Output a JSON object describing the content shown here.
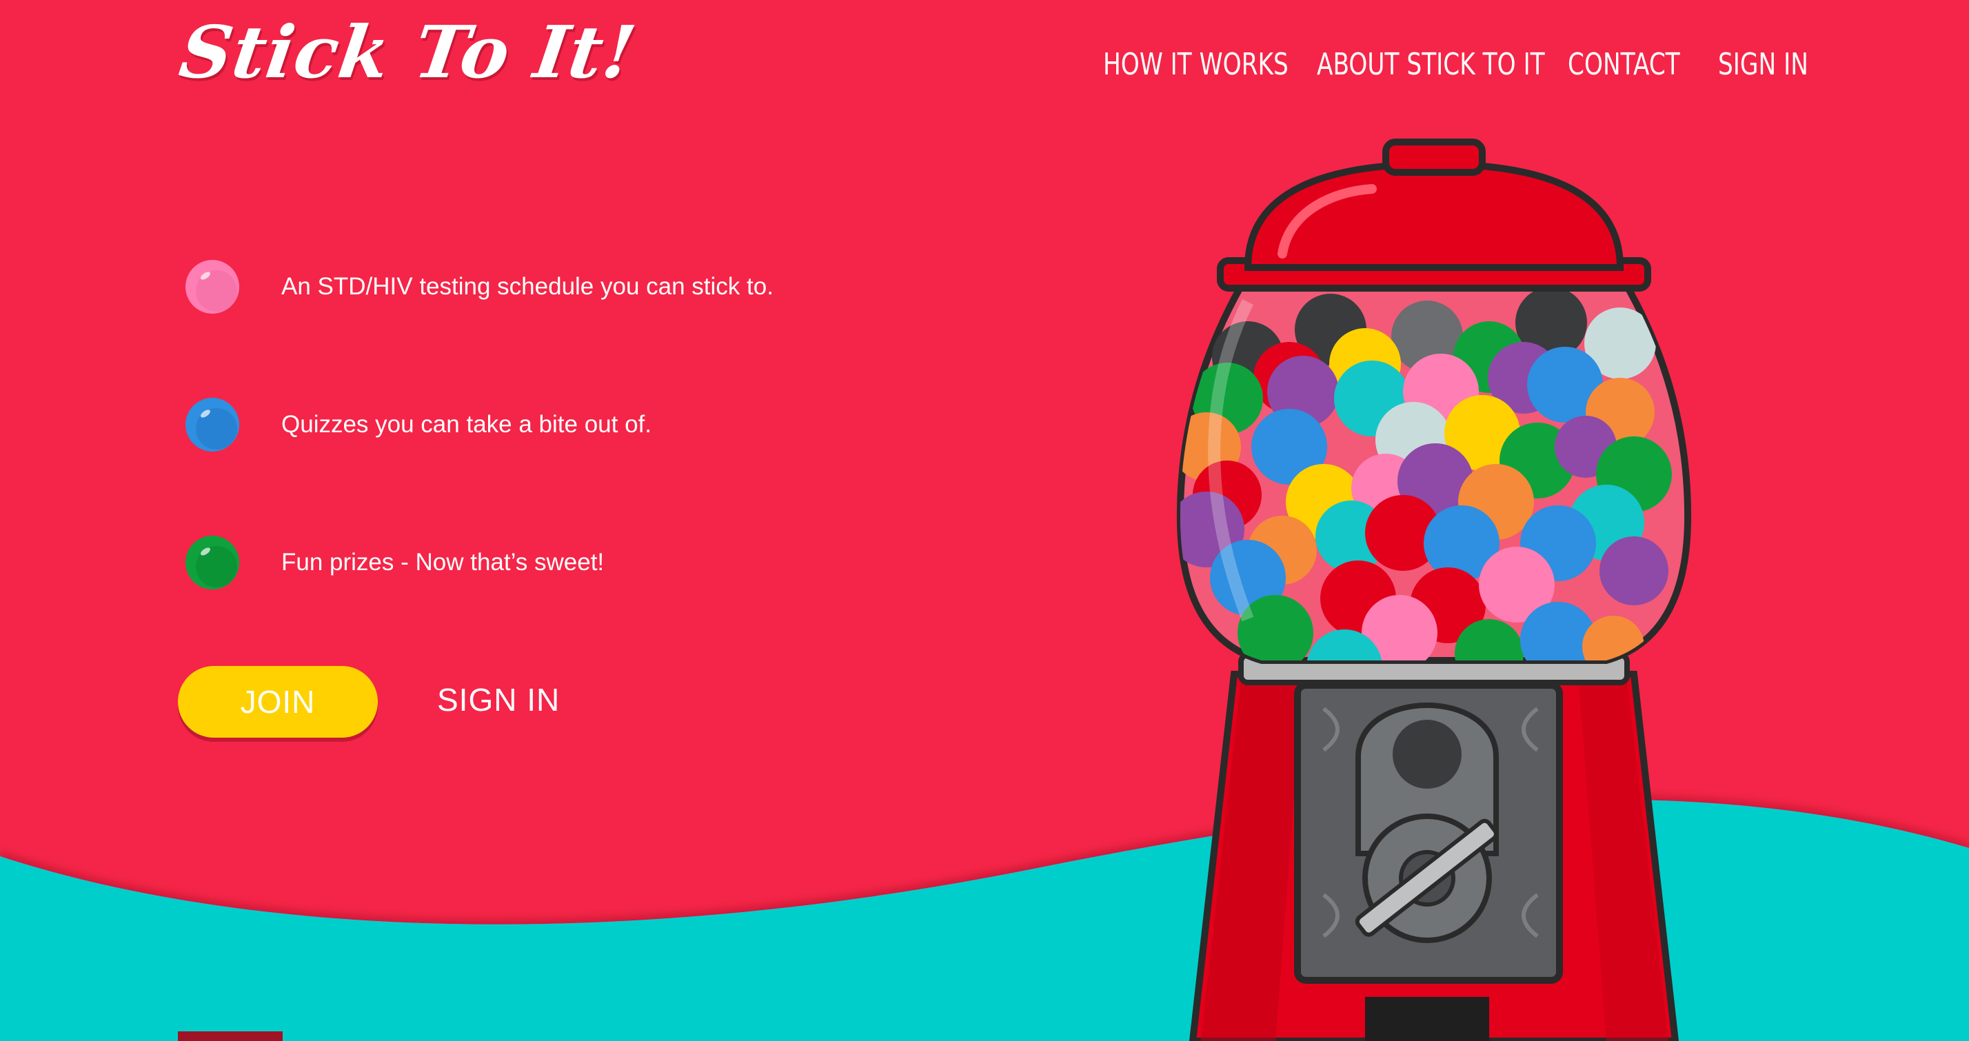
{
  "brand": {
    "logo_text": "Stick To It!"
  },
  "nav": {
    "items": [
      {
        "label": "HOW IT WORKS"
      },
      {
        "label": "ABOUT STICK TO IT"
      },
      {
        "label": "CONTACT"
      },
      {
        "label": "SIGN IN"
      }
    ]
  },
  "features": [
    {
      "text": "An STD/HIV testing schedule you can stick to.",
      "dot_color": "#ff7eb3",
      "icon": "pink-gumball-icon"
    },
    {
      "text": "Quizzes you can take a bite out of.",
      "dot_color": "#2f8fe0",
      "icon": "blue-gumball-icon"
    },
    {
      "text": "Fun prizes - Now that’s sweet!",
      "dot_color": "#0fa23c",
      "icon": "green-gumball-icon"
    }
  ],
  "cta": {
    "join_label": "JOIN",
    "signin_label": "SIGN IN"
  },
  "colors": {
    "background": "#f42548",
    "wave": "#00cecb",
    "join_button": "#ffd100",
    "machine_red": "#e3001b"
  }
}
